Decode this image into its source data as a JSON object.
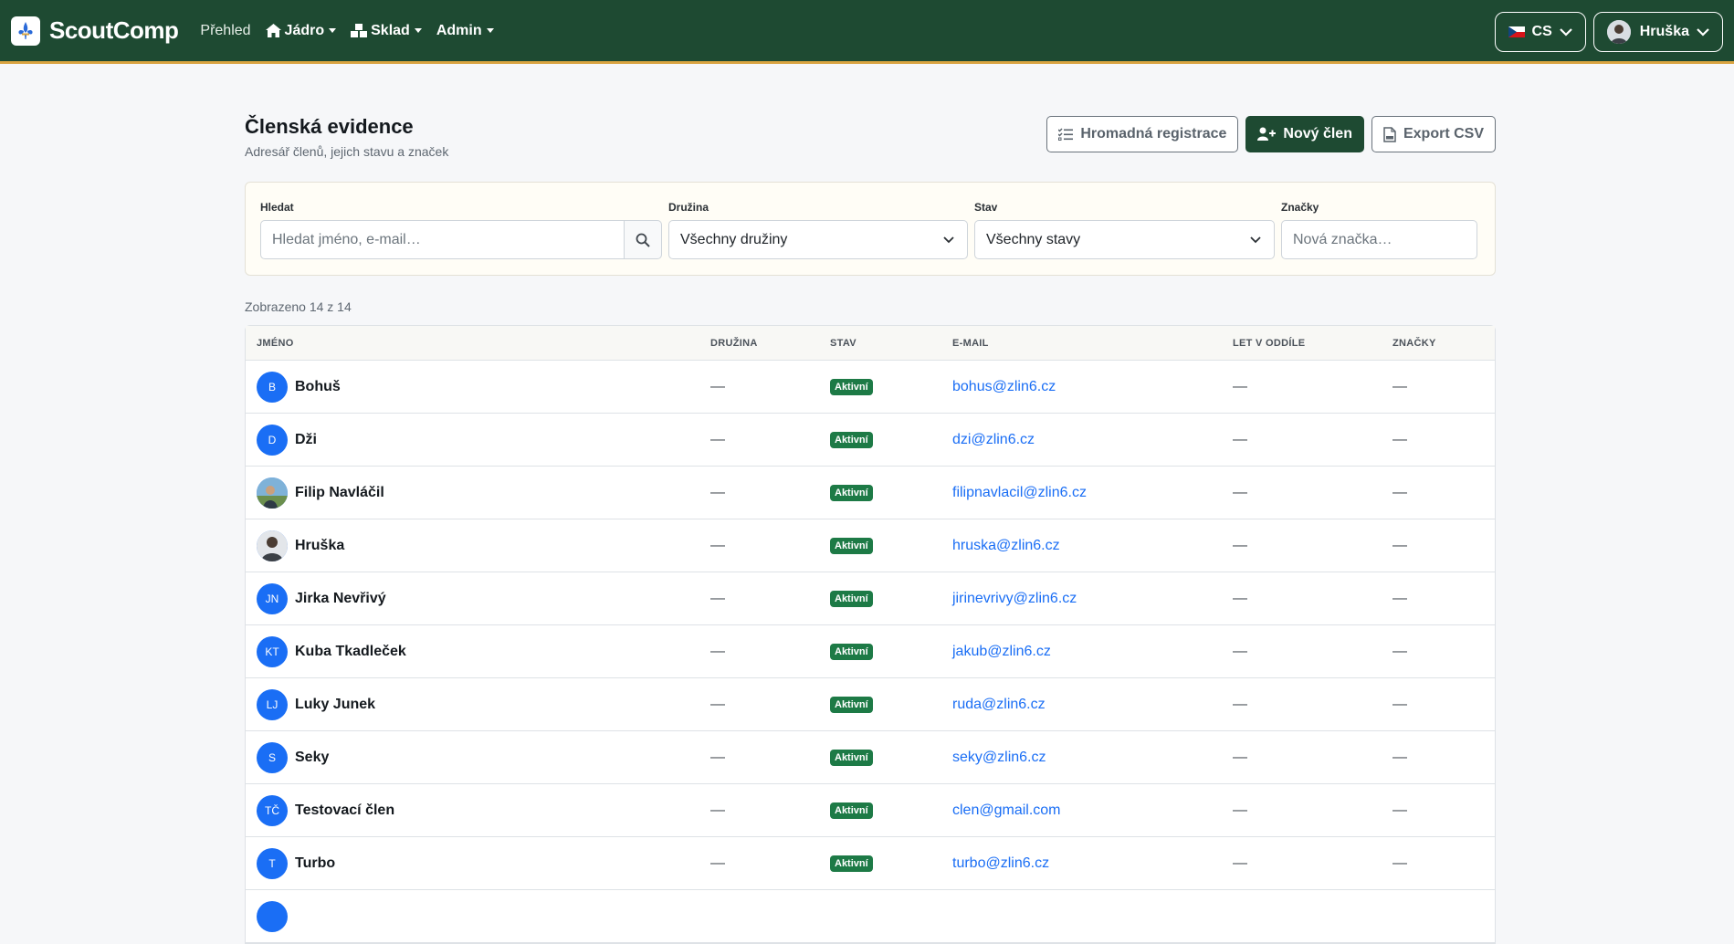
{
  "app": {
    "name": "ScoutComp"
  },
  "nav": {
    "overview": "Přehled",
    "core": "Jádro",
    "warehouse": "Sklad",
    "admin": "Admin",
    "lang": "CS",
    "user": "Hruška"
  },
  "page": {
    "title": "Členská evidence",
    "subtitle": "Adresář členů, jejich stavu a značek",
    "btn_bulk": "Hromadná registrace",
    "btn_new": "Nový člen",
    "btn_export": "Export CSV"
  },
  "filters": {
    "search_label": "Hledat",
    "search_placeholder": "Hledat jméno, e-mail…",
    "patrol_label": "Družina",
    "patrol_value": "Všechny družiny",
    "status_label": "Stav",
    "status_value": "Všechny stavy",
    "tags_label": "Značky",
    "tags_placeholder": "Nová značka…"
  },
  "count_text": "Zobrazeno 14 z 14",
  "table": {
    "headers": {
      "name": "JMÉNO",
      "patrol": "DRUŽINA",
      "status": "STAV",
      "email": "E-MAIL",
      "years": "LET V ODDÍLE",
      "tags": "ZNAČKY"
    },
    "rows": [
      {
        "initials": "B",
        "name": "Bohuš",
        "patrol": "—",
        "status": "Aktivní",
        "email": "bohus@zlin6.cz",
        "years": "—",
        "tags": "—"
      },
      {
        "initials": "D",
        "name": "Dži",
        "patrol": "—",
        "status": "Aktivní",
        "email": "dzi@zlin6.cz",
        "years": "—",
        "tags": "—"
      },
      {
        "initials": "",
        "name": "Filip Navláčil",
        "patrol": "—",
        "status": "Aktivní",
        "email": "filipnavlacil@zlin6.cz",
        "years": "—",
        "tags": "—"
      },
      {
        "initials": "",
        "name": "Hruška",
        "patrol": "—",
        "status": "Aktivní",
        "email": "hruska@zlin6.cz",
        "years": "—",
        "tags": "—"
      },
      {
        "initials": "JN",
        "name": "Jirka Nevřivý",
        "patrol": "—",
        "status": "Aktivní",
        "email": "jirinevrivy@zlin6.cz",
        "years": "—",
        "tags": "—"
      },
      {
        "initials": "KT",
        "name": "Kuba Tkadleček",
        "patrol": "—",
        "status": "Aktivní",
        "email": "jakub@zlin6.cz",
        "years": "—",
        "tags": "—"
      },
      {
        "initials": "LJ",
        "name": "Luky Junek",
        "patrol": "—",
        "status": "Aktivní",
        "email": "ruda@zlin6.cz",
        "years": "—",
        "tags": "—"
      },
      {
        "initials": "S",
        "name": "Seky",
        "patrol": "—",
        "status": "Aktivní",
        "email": "seky@zlin6.cz",
        "years": "—",
        "tags": "—"
      },
      {
        "initials": "TČ",
        "name": "Testovací člen",
        "patrol": "—",
        "status": "Aktivní",
        "email": "clen@gmail.com",
        "years": "—",
        "tags": "—"
      },
      {
        "initials": "T",
        "name": "Turbo",
        "patrol": "—",
        "status": "Aktivní",
        "email": "turbo@zlin6.cz",
        "years": "—",
        "tags": "—"
      }
    ]
  }
}
